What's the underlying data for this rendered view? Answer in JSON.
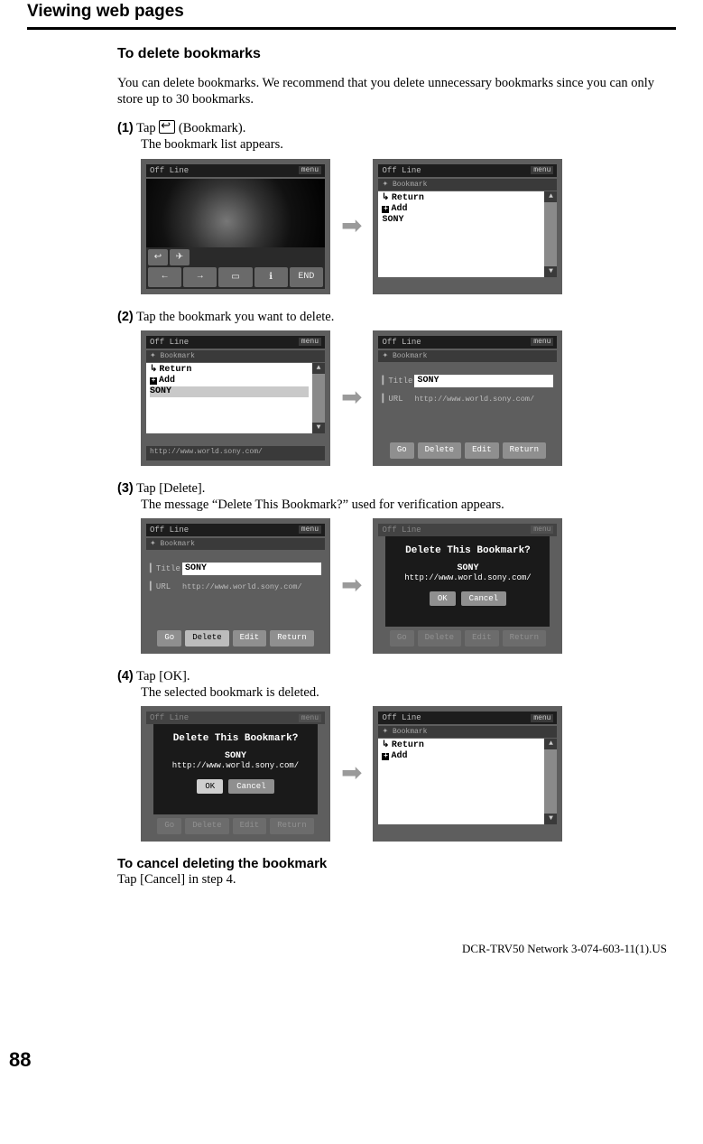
{
  "header": {
    "title": "Viewing web pages"
  },
  "section": {
    "h1": "To delete bookmarks",
    "intro": "You can delete bookmarks. We recommend that you delete unnecessary bookmarks since you can only store up to 30 bookmarks.",
    "step1_num": "(1)",
    "step1_a": "Tap ",
    "step1_b": " (Bookmark).",
    "step1_sub": "The bookmark list appears.",
    "step2_num": "(2)",
    "step2": "Tap the bookmark you want to delete.",
    "step3_num": "(3)",
    "step3_a": "Tap [Delete].",
    "step3_sub": "The message “Delete This Bookmark?” used for verification appears.",
    "step4_num": "(4)",
    "step4_a": "Tap [OK].",
    "step4_sub": "The selected bookmark is deleted.",
    "cancel_h": "To cancel deleting the bookmark",
    "cancel_t": "Tap [Cancel] in step 4."
  },
  "ui": {
    "offline": "Off Line",
    "menu": "menu",
    "bookmark_label": "Bookmark",
    "list": {
      "return": "Return",
      "add": "Add",
      "sony": "SONY"
    },
    "footer_url": "http://www.world.sony.com/",
    "title_lbl": "Title",
    "url_lbl": "URL",
    "title_val": "SONY",
    "url_val": "http://www.world.sony.com/",
    "btns": {
      "go": "Go",
      "delete": "Delete",
      "edit": "Edit",
      "return": "Return"
    },
    "dialog": {
      "q": "Delete This Bookmark?",
      "name": "SONY",
      "url": "http://www.world.sony.com/",
      "ok": "OK",
      "cancel": "Cancel"
    },
    "toolbar": {
      "end": "END"
    }
  },
  "page_number": "88",
  "footer_model": "DCR-TRV50 Network 3-074-603-11(1).US"
}
